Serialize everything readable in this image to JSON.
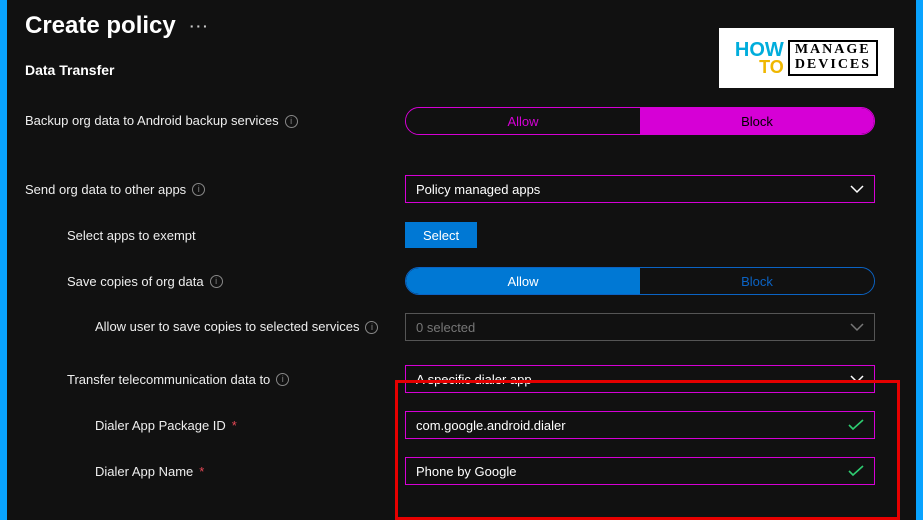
{
  "title": "Create policy",
  "section": "Data Transfer",
  "logo": {
    "how": "HOW",
    "to": "TO",
    "line1": "MANAGE",
    "line2": "DEVICES"
  },
  "rows": {
    "backup": {
      "label": "Backup org data to Android backup services",
      "allow": "Allow",
      "block": "Block"
    },
    "sendorg": {
      "label": "Send org data to other apps",
      "value": "Policy managed apps"
    },
    "exempt": {
      "label": "Select apps to exempt",
      "button": "Select"
    },
    "savecopy": {
      "label": "Save copies of org data",
      "allow": "Allow",
      "block": "Block"
    },
    "allowsave": {
      "label": "Allow user to save copies to selected services",
      "value": "0 selected"
    },
    "telecom": {
      "label": "Transfer telecommunication data to",
      "value": "A specific dialer app"
    },
    "pkgid": {
      "label": "Dialer App Package ID",
      "value": "com.google.android.dialer"
    },
    "appname": {
      "label": "Dialer App Name",
      "value": "Phone by Google"
    }
  }
}
